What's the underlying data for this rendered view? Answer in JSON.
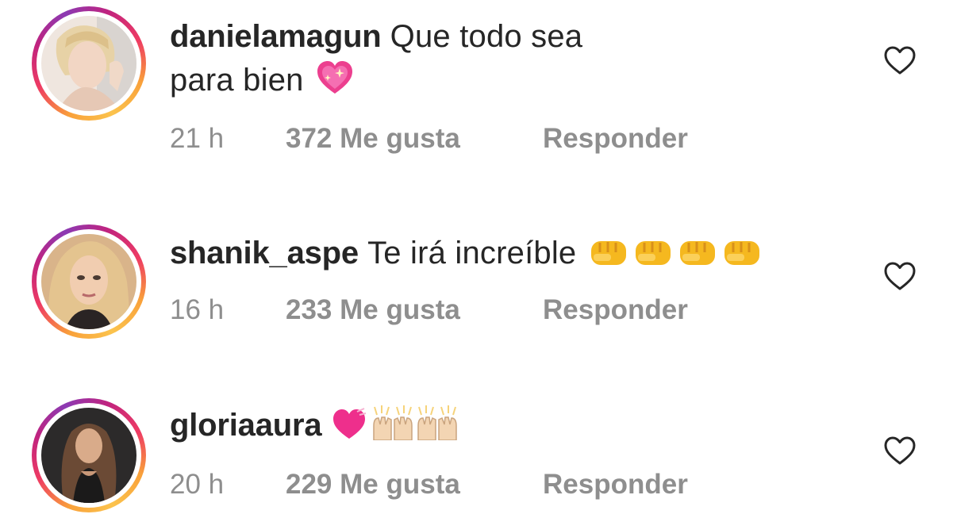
{
  "comments": [
    {
      "username": "danielamagun",
      "text_line1": "Que todo sea",
      "text_line2": "para bien",
      "emojis": [
        "sparkling-heart"
      ],
      "time": "21 h",
      "likes": "372 Me gusta",
      "reply": "Responder",
      "like_icon": "heart-outline-icon"
    },
    {
      "username": "shanik_aspe",
      "text_line1": "Te irá increíble",
      "emojis": [
        "fist",
        "fist",
        "fist",
        "fist"
      ],
      "time": "16 h",
      "likes": "233 Me gusta",
      "reply": "Responder",
      "like_icon": "heart-outline-icon"
    },
    {
      "username": "gloriaaura",
      "text_line1": "",
      "emojis": [
        "heart-with-ribbon",
        "raising-hands",
        "raising-hands"
      ],
      "time": "20 h",
      "likes": "229 Me gusta",
      "reply": "Responder",
      "like_icon": "heart-outline-icon"
    }
  ],
  "colors": {
    "text": "#262626",
    "meta": "#8e8e8e",
    "story_ring_start": "#f9a13a",
    "story_ring_end": "#c0237f"
  }
}
